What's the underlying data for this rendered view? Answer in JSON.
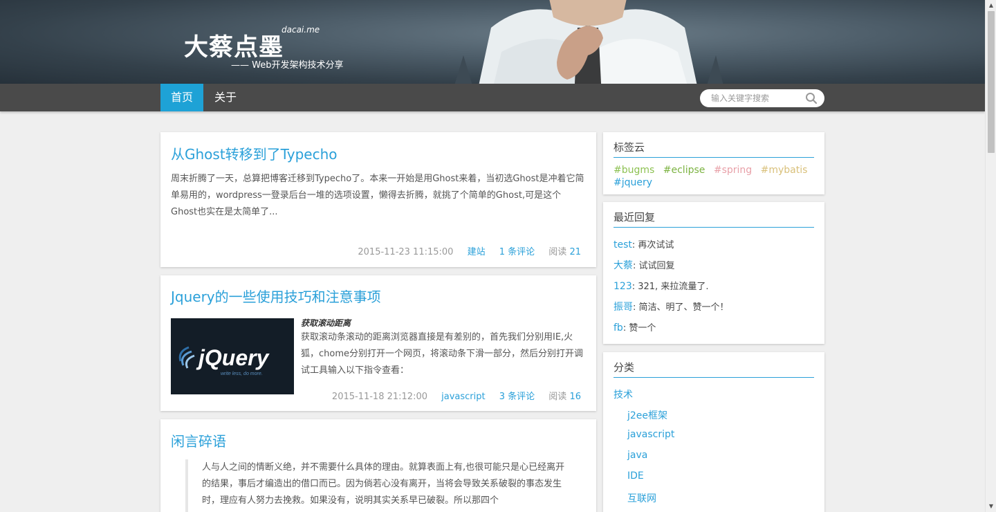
{
  "header": {
    "title": "大蔡点墨",
    "domain": "dacai.me",
    "subtitle": "—— Web开发架构技术分享"
  },
  "nav": {
    "items": [
      {
        "label": "首页",
        "active": true
      },
      {
        "label": "关于",
        "active": false
      }
    ],
    "search_placeholder": "输入关键字搜索",
    "accent_color": "#1ea2d6"
  },
  "posts": [
    {
      "title": "从Ghost转移到了Typecho",
      "excerpt": "周末折腾了一天，总算把博客迁移到Typecho了。本来一开始是用Ghost来着，当初选Ghost是冲着它简单易用的，wordpress一登录后台一堆的选项设置，懒得去折腾，就挑了个简单的Ghost,可是这个Ghost也实在是太简单了...",
      "date": "2015-11-23 11:15:00",
      "category": "建站",
      "comments": "1 条评论",
      "views_label": "阅读",
      "views": "21"
    },
    {
      "title": "Jquery的一些使用技巧和注意事项",
      "excerpt_heading": "获取滚动距离",
      "excerpt": "获取滚动条滚动的距离浏览器直接是有差别的，首先我们分别用IE,火狐，chome分别打开一个网页，将滚动条下滑一部分，然后分别打开调试工具输入以下指令查看：",
      "thumbnail": {
        "logo_text": "jQuery",
        "tagline": "write less, do more."
      },
      "date": "2015-11-18 21:12:00",
      "category": "javascript",
      "comments": "3 条评论",
      "views_label": "阅读",
      "views": "16"
    },
    {
      "title": "闲言碎语",
      "quote": "人与人之间的情断义绝，并不需要什么具体的理由。就算表面上有,也很可能只是心已经离开的结果，事后才编造出的借口而已。因为倘若心没有离开，当将会导致关系破裂的事态发生时，理应有人努力去挽救。如果没有，说明其实关系早已破裂。所以那四个"
    }
  ],
  "sidebar": {
    "tags": {
      "title": "标签云",
      "items": [
        {
          "label": "#bugms",
          "color": "#8dc152"
        },
        {
          "label": "#eclipse",
          "color": "#7cb342"
        },
        {
          "label": "#spring",
          "color": "#e8a0a8"
        },
        {
          "label": "#mybatis",
          "color": "#d9c07a"
        },
        {
          "label": "#jquery",
          "color": "#2aa0d9"
        }
      ]
    },
    "recent_replies": {
      "title": "最近回复",
      "items": [
        {
          "author": "test",
          "text": ": 再次试试"
        },
        {
          "author": "大蔡",
          "text": ": 试试回复"
        },
        {
          "author": "123",
          "text": ": 321, 来拉流量了."
        },
        {
          "author": "振哥",
          "text": ": 简洁、明了、赞一个！"
        },
        {
          "author": "fb",
          "text": ": 赞一个"
        }
      ]
    },
    "categories": {
      "title": "分类",
      "items": [
        {
          "label": "技术",
          "sub": false
        },
        {
          "label": "j2ee框架",
          "sub": true
        },
        {
          "label": "javascript",
          "sub": true
        },
        {
          "label": "java",
          "sub": true
        },
        {
          "label": "IDE",
          "sub": true
        },
        {
          "label": "互联网",
          "sub": true
        }
      ]
    }
  }
}
